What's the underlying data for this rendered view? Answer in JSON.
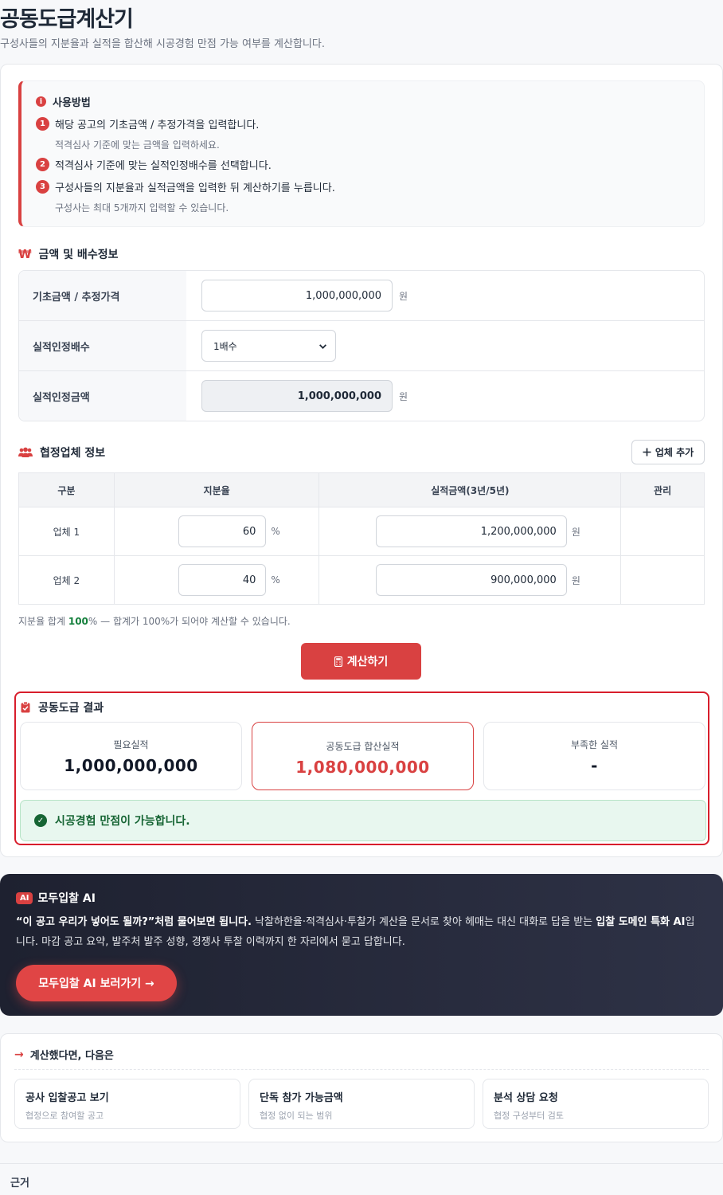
{
  "header": {
    "title": "공동도급계산기",
    "subtitle": "구성사들의 지분율과 실적을 합산해 시공경험 만점 가능 여부를 계산합니다."
  },
  "howto": {
    "title": "사용방법",
    "steps": [
      {
        "num": "1",
        "text": "해당 공고의 기초금액 / 추정가격을 입력합니다.",
        "sub": "적격심사 기준에 맞는 금액을 입력하세요."
      },
      {
        "num": "2",
        "text": "적격심사 기준에 맞는 실적인정배수를 선택합니다.",
        "sub": ""
      },
      {
        "num": "3",
        "text": "구성사들의 지분율과 실적금액을 입력한 뒤 계산하기를 누릅니다.",
        "sub": "구성사는 최대 5개까지 입력할 수 있습니다."
      }
    ]
  },
  "amount_section": {
    "title": "금액 및 배수정보",
    "icon": "won-icon",
    "rows": [
      {
        "label": "기초금액 / 추정가격",
        "value": "1,000,000,000",
        "unit": "원"
      },
      {
        "label": "실적인정배수",
        "value": "1배수"
      },
      {
        "label": "실적인정금액",
        "value": "1,000,000,000",
        "unit": "원"
      }
    ]
  },
  "firm_section": {
    "title": "협정업체 정보",
    "add_button": "업체 추가",
    "columns": [
      "구분",
      "지분율",
      "실적금액(3년/5년)",
      "관리"
    ],
    "rows": [
      {
        "name": "업체 1",
        "share": "60",
        "share_unit": "%",
        "amount": "1,200,000,000",
        "amount_unit": "원"
      },
      {
        "name": "업체 2",
        "share": "40",
        "share_unit": "%",
        "amount": "900,000,000",
        "amount_unit": "원"
      }
    ],
    "sum_prefix": "지분율 합계 ",
    "sum_value": "100",
    "sum_suffix": "% — 합계가 100%가 되어야 계산할 수 있습니다."
  },
  "calc_button": "계산하기",
  "result": {
    "title": "공동도급 결과",
    "cards": [
      {
        "label": "필요실적",
        "value": "1,000,000,000"
      },
      {
        "label": "공동도급 합산실적",
        "value": "1,080,000,000"
      },
      {
        "label": "부족한 실적",
        "value": "-"
      }
    ],
    "status": "시공경험 만점이 가능합니다."
  },
  "ai_promo": {
    "badge": "AI",
    "title": "모두입찰 AI",
    "quote": "“이 공고 우리가 넣어도 될까?”처럼 물어보면 됩니다.",
    "body1": " 낙찰하한율·적격심사·투찰가 계산을 문서로 찾아 헤매는 대신 대화로 답을 받는 ",
    "bold2": "입찰 도메인 특화 AI",
    "body2": "입니다. 마감 공고 요약, 발주처 발주 성향, 경쟁사 투찰 이력까지 한 자리에서 묻고 답합니다.",
    "button": "모두입찰 AI 보러가기 →"
  },
  "next": {
    "title": "계산했다면, 다음은",
    "items": [
      {
        "title": "공사 입찰공고 보기",
        "sub": "협정으로 참여할 공고"
      },
      {
        "title": "단독 참가 가능금액",
        "sub": "협정 없이 되는 범위"
      },
      {
        "title": "분석 상담 요청",
        "sub": "협정 구성부터 검토"
      }
    ]
  },
  "basis": {
    "title": "근거"
  },
  "colors": {
    "accent": "#d94141",
    "success": "#166534",
    "dark": "#1e2130"
  }
}
